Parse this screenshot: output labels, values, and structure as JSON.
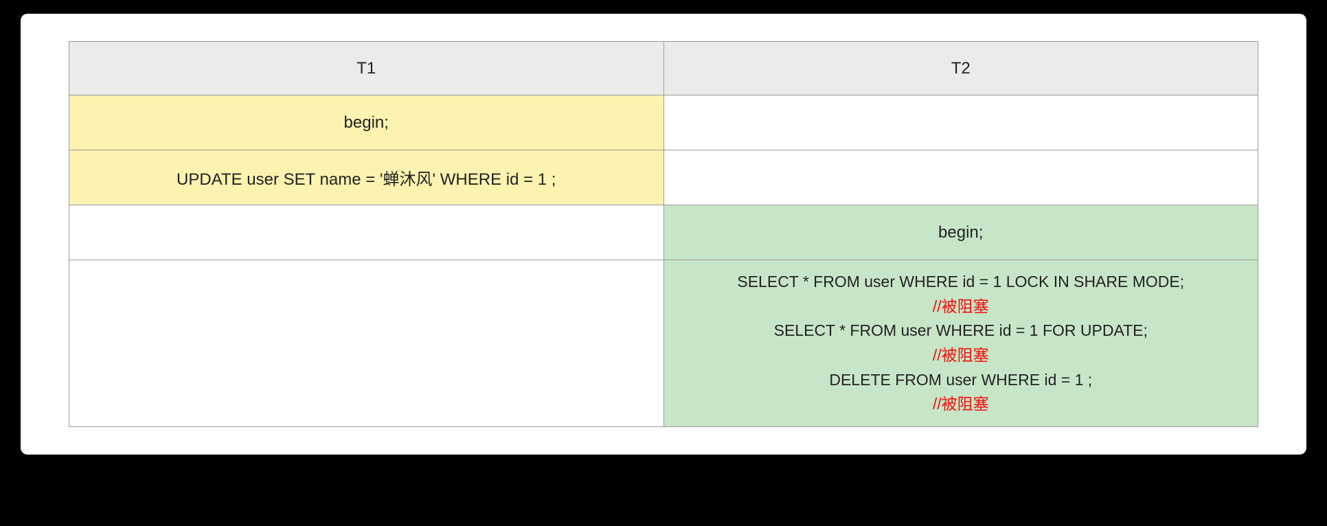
{
  "headers": {
    "t1": "T1",
    "t2": "T2"
  },
  "rows": {
    "r1": {
      "t1": "begin;",
      "t2": ""
    },
    "r2": {
      "t1": "UPDATE user SET name = '蝉沐风' WHERE id = 1 ;",
      "t2": ""
    },
    "r3": {
      "t1": "",
      "t2": "begin;"
    },
    "r4": {
      "t1": "",
      "t2_lines": [
        {
          "text": "SELECT * FROM user WHERE id = 1 LOCK IN SHARE MODE;",
          "red": false
        },
        {
          "text": "//被阻塞",
          "red": true
        },
        {
          "text": "SELECT * FROM user WHERE id = 1 FOR UPDATE;",
          "red": false
        },
        {
          "text": "//被阻塞",
          "red": true
        },
        {
          "text": "DELETE FROM user WHERE id = 1 ;",
          "red": false
        },
        {
          "text": "//被阻塞",
          "red": true
        }
      ]
    }
  }
}
